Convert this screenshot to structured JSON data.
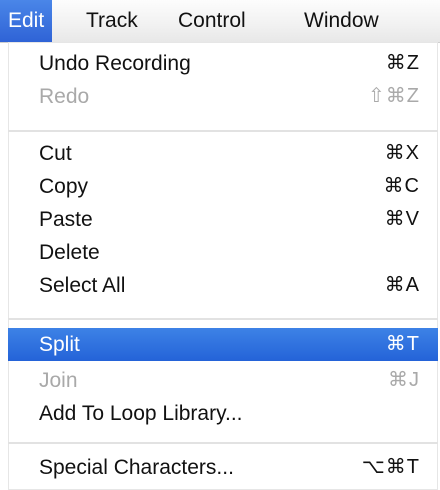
{
  "menubar": {
    "items": [
      {
        "label": "Edit",
        "active": true
      },
      {
        "label": "Track",
        "active": false
      },
      {
        "label": "Control",
        "active": false
      },
      {
        "label": "Window",
        "active": false
      }
    ]
  },
  "edit_menu": {
    "items": [
      {
        "label": "Undo Recording",
        "shortcut": "⌘Z",
        "enabled": true
      },
      {
        "label": "Redo",
        "shortcut": "⇧⌘Z",
        "enabled": false
      },
      {
        "label": "Cut",
        "shortcut": "⌘X",
        "enabled": true
      },
      {
        "label": "Copy",
        "shortcut": "⌘C",
        "enabled": true
      },
      {
        "label": "Paste",
        "shortcut": "⌘V",
        "enabled": true
      },
      {
        "label": "Delete",
        "shortcut": "",
        "enabled": true
      },
      {
        "label": "Select All",
        "shortcut": "⌘A",
        "enabled": true
      },
      {
        "label": "Split",
        "shortcut": "⌘T",
        "enabled": true,
        "highlighted": true
      },
      {
        "label": "Join",
        "shortcut": "⌘J",
        "enabled": false
      },
      {
        "label": "Add To Loop Library...",
        "shortcut": "",
        "enabled": true
      },
      {
        "label": "Special Characters...",
        "shortcut": "⌥⌘T",
        "enabled": true
      }
    ]
  },
  "colors": {
    "highlight": "#2f6de0",
    "text": "#111111",
    "disabled_text": "#a9a9a9",
    "separator": "#e2e2e2"
  }
}
